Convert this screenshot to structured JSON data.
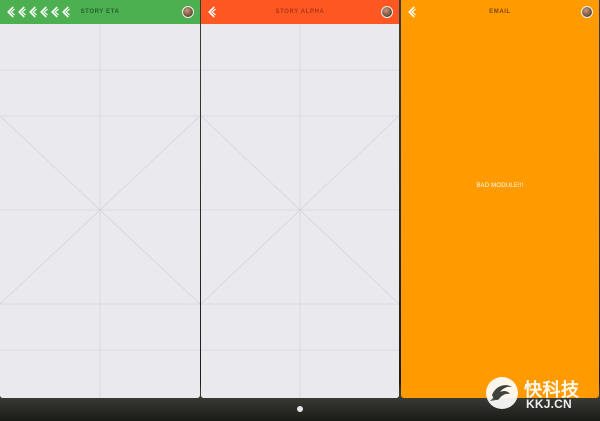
{
  "cards": [
    {
      "id": "eta",
      "title": "STORY ETA",
      "back_icon_count": 6,
      "header_color": "#4caf50"
    },
    {
      "id": "alpha",
      "title": "STORY ALPHA",
      "back_icon_count": 1,
      "header_color": "#ff5722"
    },
    {
      "id": "email",
      "title": "EMAIL",
      "back_icon_count": 1,
      "header_color": "#ff9a00",
      "body_text": "BAD MODULE!!!"
    }
  ],
  "pager": {
    "current_page": 1,
    "total_pages": 1
  },
  "watermark": {
    "line1": "快科技",
    "line2": "KKJ.CN"
  }
}
